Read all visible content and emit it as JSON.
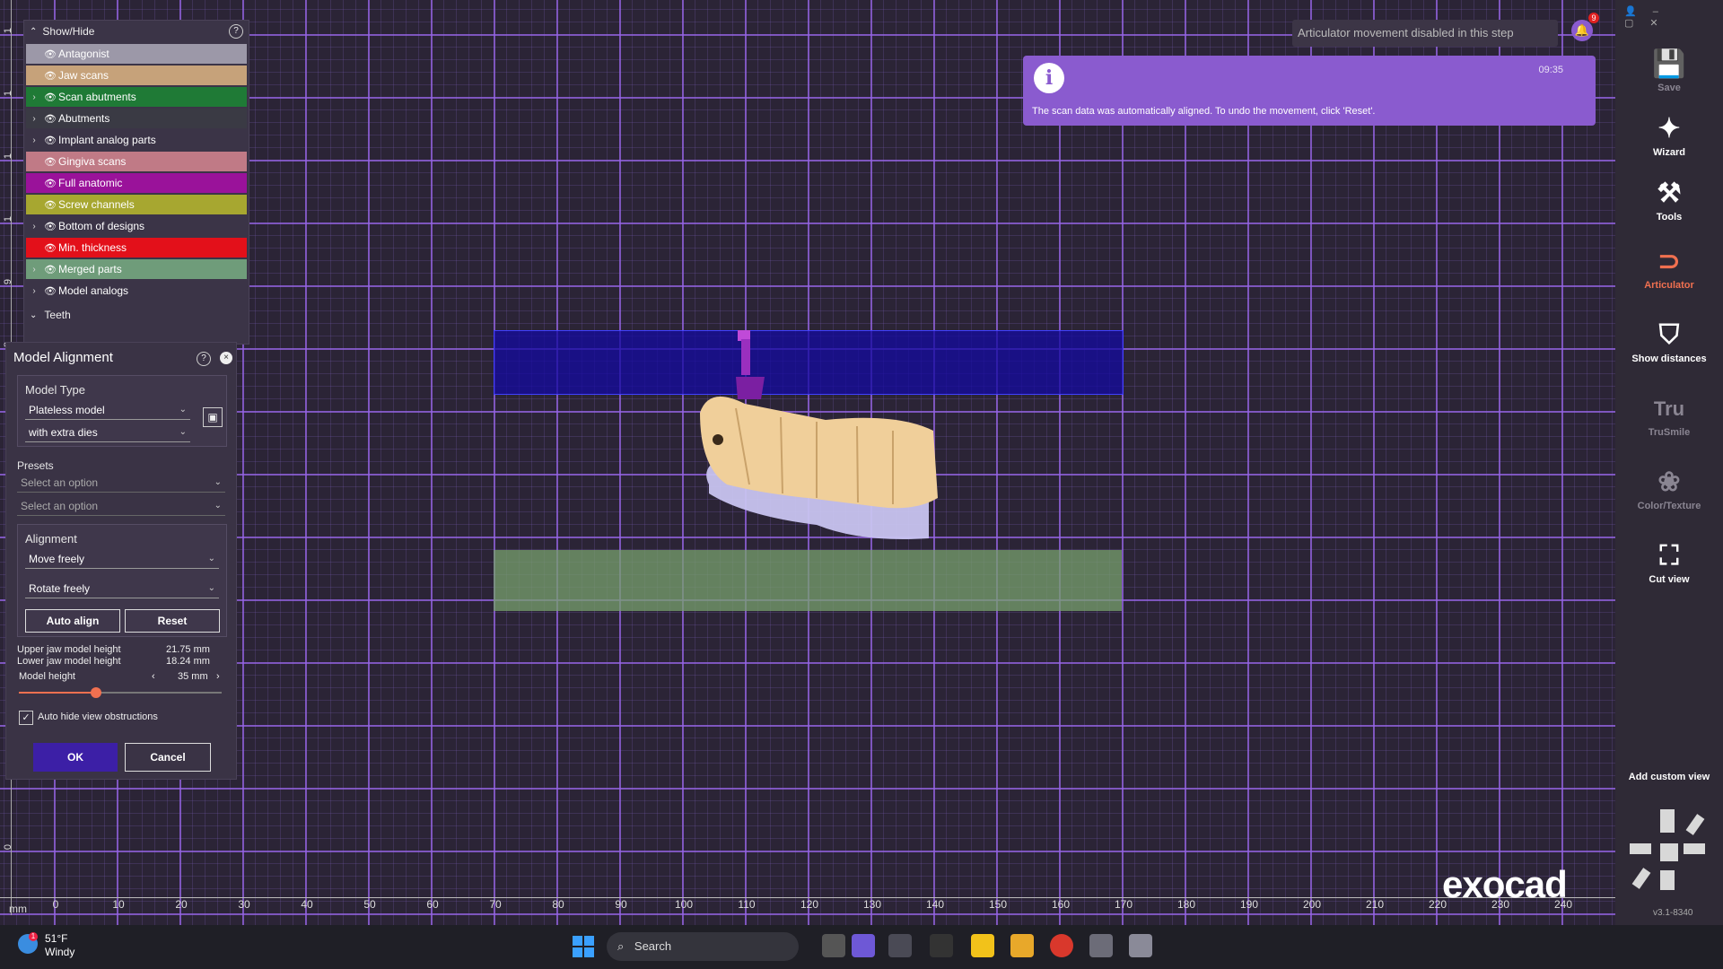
{
  "ruler": {
    "unit": "mm",
    "x_ticks": [
      "0",
      "10",
      "20",
      "30",
      "40",
      "50",
      "60",
      "70",
      "80",
      "90",
      "100",
      "110",
      "120",
      "130",
      "140",
      "150",
      "160",
      "170",
      "180",
      "190",
      "200",
      "210",
      "220",
      "230",
      "240"
    ],
    "y_ticks": [
      "1",
      "1",
      "1",
      "1",
      "9",
      "8",
      "0"
    ]
  },
  "showhide": {
    "title": "Show/Hide",
    "items": [
      {
        "label": "Antagonist",
        "color": "#9c98a8",
        "arrow": false
      },
      {
        "label": "Jaw scans",
        "color": "#c6a27a",
        "arrow": false
      },
      {
        "label": "Scan abutments",
        "color": "#1f7a36",
        "arrow": true
      },
      {
        "label": "Abutments",
        "color": "#3a3a44",
        "arrow": true
      },
      {
        "label": "Implant analog parts",
        "color": "#3b3447",
        "arrow": true
      },
      {
        "label": "Gingiva scans",
        "color": "#c07a86",
        "arrow": false
      },
      {
        "label": "Full anatomic",
        "color": "#9a129a",
        "arrow": false
      },
      {
        "label": "Screw channels",
        "color": "#a7a730",
        "arrow": false
      },
      {
        "label": "Bottom of designs",
        "color": "#3b3447",
        "arrow": true
      },
      {
        "label": "Min. thickness",
        "color": "#e3101a",
        "arrow": false
      },
      {
        "label": "Merged parts",
        "color": "#6f9c7a",
        "arrow": true
      },
      {
        "label": "Model analogs",
        "color": "#3b3447",
        "arrow": true
      }
    ],
    "teeth_label": "Teeth"
  },
  "model_alignment": {
    "title": "Model Alignment",
    "model_type_label": "Model Type",
    "model_type_value": "Plateless model",
    "dies_value": "with extra dies",
    "presets_label": "Presets",
    "preset1": "Select an option",
    "preset2": "Select an option",
    "alignment_label": "Alignment",
    "move_value": "Move freely",
    "rotate_value": "Rotate freely",
    "auto_align": "Auto align",
    "reset": "Reset",
    "upper_label": "Upper jaw model height",
    "upper_value": "21.75 mm",
    "lower_label": "Lower jaw model height",
    "lower_value": "18.24 mm",
    "height_label": "Model height",
    "height_value": "35 mm",
    "slider_fraction": 0.38,
    "auto_hide_label": "Auto hide view obstructions",
    "auto_hide_checked": true,
    "ok": "OK",
    "cancel": "Cancel"
  },
  "notifications": {
    "toast": "Articulator movement disabled in this step",
    "info_message": "The scan data was automatically aligned. To undo the movement, click 'Reset'.",
    "info_time": "09:35",
    "badge_count": "9"
  },
  "toolbar": {
    "save": "Save",
    "wizard": "Wizard",
    "tools": "Tools",
    "articulator": "Articulator",
    "show_distances": "Show distances",
    "trusmile_glyph": "Tru",
    "trusmile": "TruSmile",
    "color_texture": "Color/Texture",
    "cut_view": "Cut view",
    "add_custom_view": "Add custom view",
    "version": "v3.1-8340"
  },
  "logo": "exocad",
  "taskbar": {
    "temp": "51°F",
    "weather": "Windy",
    "search_placeholder": "Search"
  },
  "colors": {
    "accent": "#8a5bcf",
    "articulator_active": "#f07050",
    "ok_button": "#3c1fa6"
  }
}
